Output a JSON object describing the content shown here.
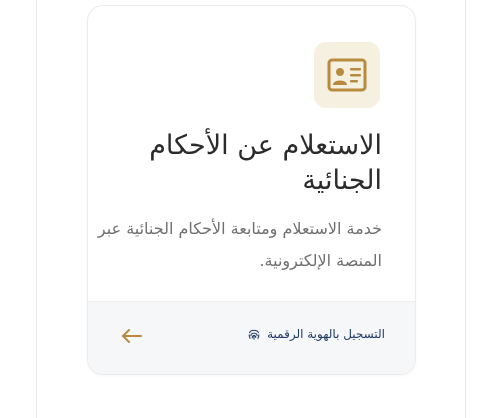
{
  "service_card": {
    "title": "الاستعلام عن الأحكام الجنائية",
    "description": "خدمة الاستعلام ومتابعة الأحكام الجنائية عبر المنصة الإلكترونية.",
    "icon": "id-card-icon",
    "action": {
      "label": "التسجيل بالهوية الرقمية",
      "icon": "fingerprint-icon",
      "arrow_icon": "arrow-left-icon"
    }
  },
  "colors": {
    "accent_gold": "#b88a3e",
    "icon_tile_bg": "#f6f0e1",
    "link_navy": "#1f3a63",
    "footer_bg": "#f6f7f9",
    "title_text": "#2b2b2b",
    "desc_text": "#6f6f6f"
  }
}
